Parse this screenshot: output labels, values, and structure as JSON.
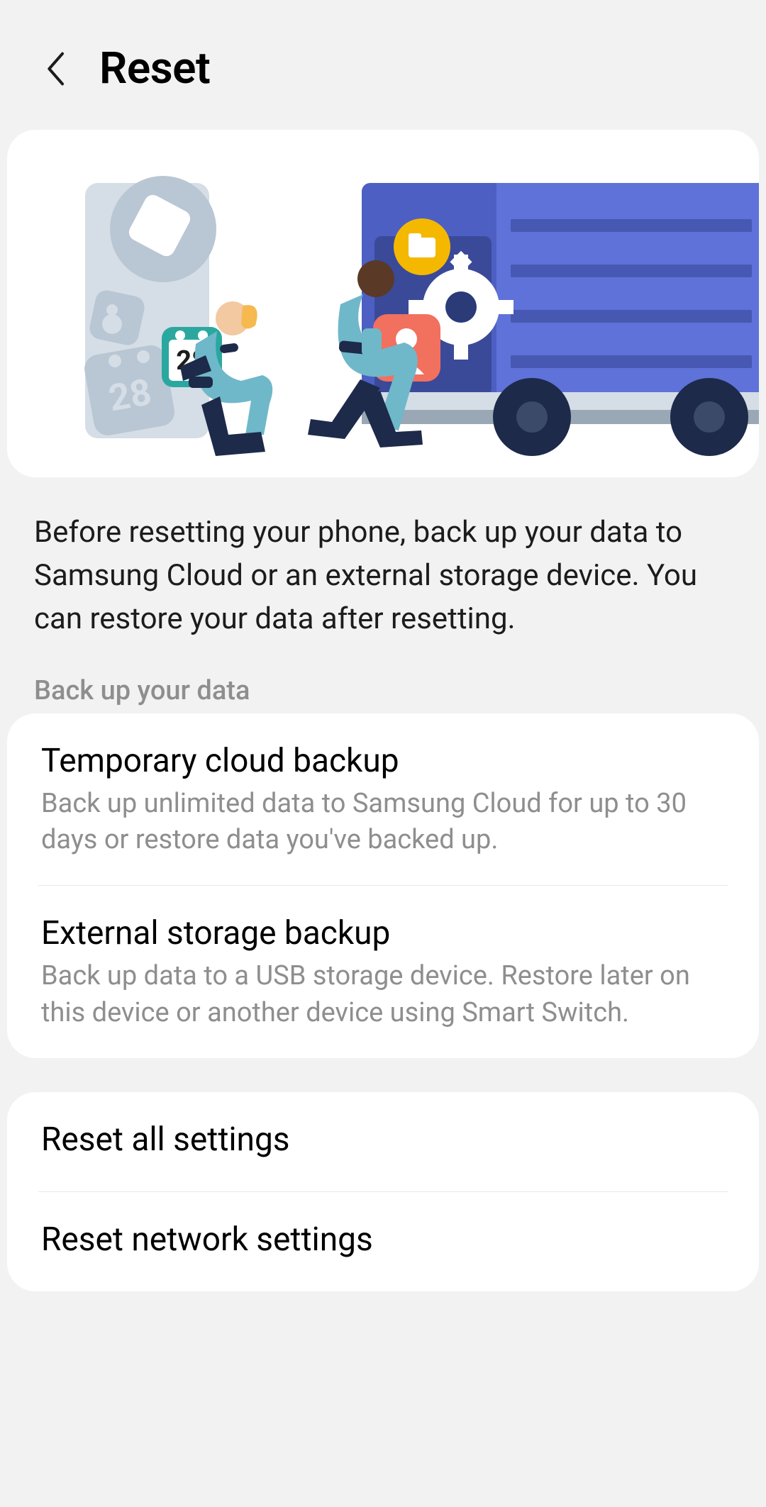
{
  "header": {
    "title": "Reset"
  },
  "intro": "Before resetting your phone, back up your data to Samsung Cloud or an external storage device. You can restore your data after resetting.",
  "section_label": "Back up your data",
  "illustration": {
    "calendar_number": "28"
  },
  "backup_options": [
    {
      "title": "Temporary cloud backup",
      "desc": "Back up unlimited data to Samsung Cloud for up to 30 days or restore data you've backed up."
    },
    {
      "title": "External storage backup",
      "desc": "Back up data to a USB storage device. Restore later on this device or another device using Smart Switch."
    }
  ],
  "reset_options": [
    {
      "title": "Reset all settings"
    },
    {
      "title": "Reset network settings"
    }
  ]
}
